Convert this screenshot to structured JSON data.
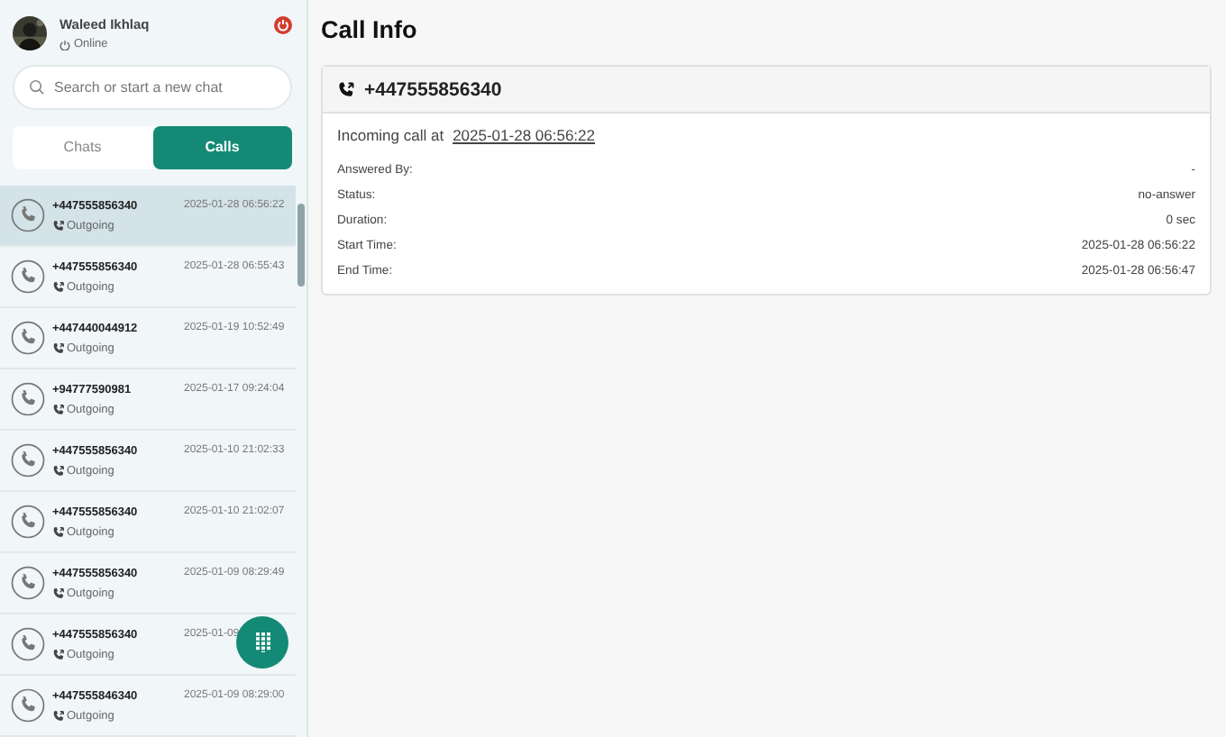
{
  "user": {
    "name": "Waleed Ikhlaq",
    "status": "Online"
  },
  "search": {
    "placeholder": "Search or start a new chat"
  },
  "tabs": [
    {
      "label": "Chats",
      "selected": false
    },
    {
      "label": "Calls",
      "selected": true
    }
  ],
  "calls": [
    {
      "number": "+447555856340",
      "time": "2025-01-28 06:56:22",
      "direction": "Outgoing",
      "selected": true
    },
    {
      "number": "+447555856340",
      "time": "2025-01-28 06:55:43",
      "direction": "Outgoing",
      "selected": false
    },
    {
      "number": "+447440044912",
      "time": "2025-01-19 10:52:49",
      "direction": "Outgoing",
      "selected": false
    },
    {
      "number": "+94777590981",
      "time": "2025-01-17 09:24:04",
      "direction": "Outgoing",
      "selected": false
    },
    {
      "number": "+447555856340",
      "time": "2025-01-10 21:02:33",
      "direction": "Outgoing",
      "selected": false
    },
    {
      "number": "+447555856340",
      "time": "2025-01-10 21:02:07",
      "direction": "Outgoing",
      "selected": false
    },
    {
      "number": "+447555856340",
      "time": "2025-01-09 08:29:49",
      "direction": "Outgoing",
      "selected": false
    },
    {
      "number": "+447555856340",
      "time": "2025-01-09",
      "direction": "Outgoing",
      "selected": false
    },
    {
      "number": "+447555846340",
      "time": "2025-01-09 08:29:00",
      "direction": "Outgoing",
      "selected": false
    }
  ],
  "page_title": "Call Info",
  "detail": {
    "number": "+447555856340",
    "incoming_label": "Incoming call at",
    "incoming_time": "2025-01-28 06:56:22",
    "fields": [
      {
        "label": "Answered By:",
        "value": "-"
      },
      {
        "label": "Status:",
        "value": "no-answer"
      },
      {
        "label": "Duration:",
        "value": "0 sec"
      },
      {
        "label": "Start Time:",
        "value": "2025-01-28 06:56:22"
      },
      {
        "label": "End Time:",
        "value": "2025-01-28 06:56:47"
      }
    ]
  }
}
